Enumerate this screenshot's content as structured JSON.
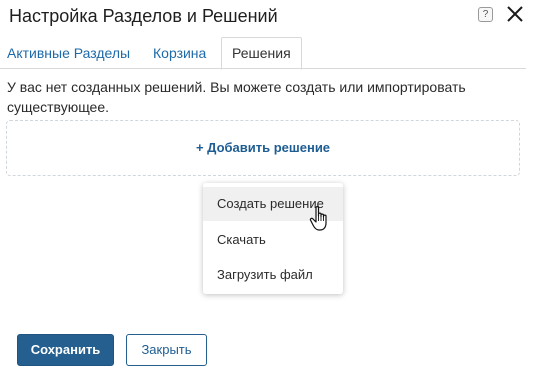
{
  "dialog": {
    "title": "Настройка Разделов и Решений",
    "help_label": "?",
    "icons": {
      "help": "help-icon",
      "close": "close-icon",
      "cursor": "hand-pointer-icon"
    }
  },
  "tabs": [
    {
      "label": "Активные Разделы",
      "active": false
    },
    {
      "label": "Корзина",
      "active": false
    },
    {
      "label": "Решения",
      "active": true
    }
  ],
  "content": {
    "info_text": "У вас нет созданных решений. Вы можете создать или импортировать существующее.",
    "add_label": "+ Добавить решение"
  },
  "menu": {
    "items": [
      {
        "label": "Создать решение",
        "hovered": true
      },
      {
        "label": "Скачать",
        "hovered": false
      },
      {
        "label": "Загрузить файл",
        "hovered": false
      }
    ]
  },
  "footer": {
    "save_label": "Сохранить",
    "close_label": "Закрыть"
  },
  "colors": {
    "accent": "#245f8f",
    "link": "#1e6aa8"
  }
}
